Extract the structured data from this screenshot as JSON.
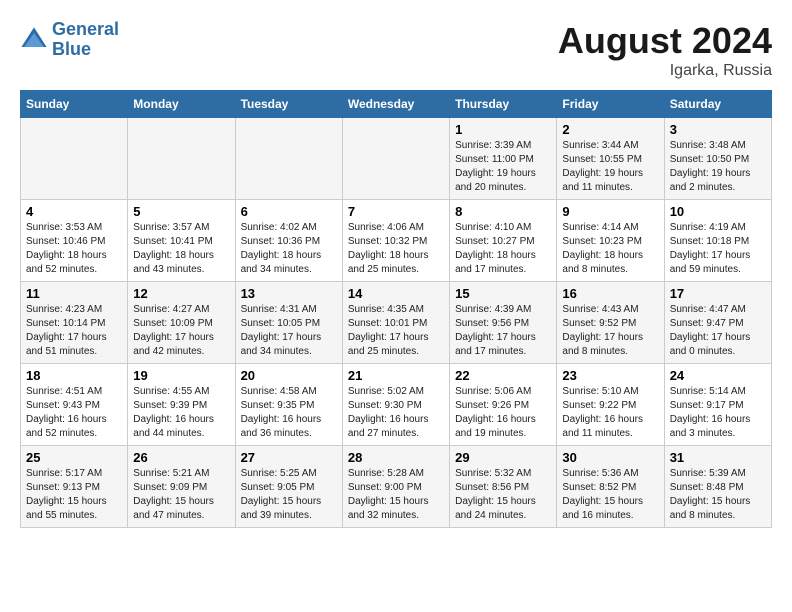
{
  "header": {
    "logo_line1": "General",
    "logo_line2": "Blue",
    "month_year": "August 2024",
    "location": "Igarka, Russia"
  },
  "weekdays": [
    "Sunday",
    "Monday",
    "Tuesday",
    "Wednesday",
    "Thursday",
    "Friday",
    "Saturday"
  ],
  "weeks": [
    [
      {
        "day": "",
        "info": ""
      },
      {
        "day": "",
        "info": ""
      },
      {
        "day": "",
        "info": ""
      },
      {
        "day": "",
        "info": ""
      },
      {
        "day": "1",
        "info": "Sunrise: 3:39 AM\nSunset: 11:00 PM\nDaylight: 19 hours\nand 20 minutes."
      },
      {
        "day": "2",
        "info": "Sunrise: 3:44 AM\nSunset: 10:55 PM\nDaylight: 19 hours\nand 11 minutes."
      },
      {
        "day": "3",
        "info": "Sunrise: 3:48 AM\nSunset: 10:50 PM\nDaylight: 19 hours\nand 2 minutes."
      }
    ],
    [
      {
        "day": "4",
        "info": "Sunrise: 3:53 AM\nSunset: 10:46 PM\nDaylight: 18 hours\nand 52 minutes."
      },
      {
        "day": "5",
        "info": "Sunrise: 3:57 AM\nSunset: 10:41 PM\nDaylight: 18 hours\nand 43 minutes."
      },
      {
        "day": "6",
        "info": "Sunrise: 4:02 AM\nSunset: 10:36 PM\nDaylight: 18 hours\nand 34 minutes."
      },
      {
        "day": "7",
        "info": "Sunrise: 4:06 AM\nSunset: 10:32 PM\nDaylight: 18 hours\nand 25 minutes."
      },
      {
        "day": "8",
        "info": "Sunrise: 4:10 AM\nSunset: 10:27 PM\nDaylight: 18 hours\nand 17 minutes."
      },
      {
        "day": "9",
        "info": "Sunrise: 4:14 AM\nSunset: 10:23 PM\nDaylight: 18 hours\nand 8 minutes."
      },
      {
        "day": "10",
        "info": "Sunrise: 4:19 AM\nSunset: 10:18 PM\nDaylight: 17 hours\nand 59 minutes."
      }
    ],
    [
      {
        "day": "11",
        "info": "Sunrise: 4:23 AM\nSunset: 10:14 PM\nDaylight: 17 hours\nand 51 minutes."
      },
      {
        "day": "12",
        "info": "Sunrise: 4:27 AM\nSunset: 10:09 PM\nDaylight: 17 hours\nand 42 minutes."
      },
      {
        "day": "13",
        "info": "Sunrise: 4:31 AM\nSunset: 10:05 PM\nDaylight: 17 hours\nand 34 minutes."
      },
      {
        "day": "14",
        "info": "Sunrise: 4:35 AM\nSunset: 10:01 PM\nDaylight: 17 hours\nand 25 minutes."
      },
      {
        "day": "15",
        "info": "Sunrise: 4:39 AM\nSunset: 9:56 PM\nDaylight: 17 hours\nand 17 minutes."
      },
      {
        "day": "16",
        "info": "Sunrise: 4:43 AM\nSunset: 9:52 PM\nDaylight: 17 hours\nand 8 minutes."
      },
      {
        "day": "17",
        "info": "Sunrise: 4:47 AM\nSunset: 9:47 PM\nDaylight: 17 hours\nand 0 minutes."
      }
    ],
    [
      {
        "day": "18",
        "info": "Sunrise: 4:51 AM\nSunset: 9:43 PM\nDaylight: 16 hours\nand 52 minutes."
      },
      {
        "day": "19",
        "info": "Sunrise: 4:55 AM\nSunset: 9:39 PM\nDaylight: 16 hours\nand 44 minutes."
      },
      {
        "day": "20",
        "info": "Sunrise: 4:58 AM\nSunset: 9:35 PM\nDaylight: 16 hours\nand 36 minutes."
      },
      {
        "day": "21",
        "info": "Sunrise: 5:02 AM\nSunset: 9:30 PM\nDaylight: 16 hours\nand 27 minutes."
      },
      {
        "day": "22",
        "info": "Sunrise: 5:06 AM\nSunset: 9:26 PM\nDaylight: 16 hours\nand 19 minutes."
      },
      {
        "day": "23",
        "info": "Sunrise: 5:10 AM\nSunset: 9:22 PM\nDaylight: 16 hours\nand 11 minutes."
      },
      {
        "day": "24",
        "info": "Sunrise: 5:14 AM\nSunset: 9:17 PM\nDaylight: 16 hours\nand 3 minutes."
      }
    ],
    [
      {
        "day": "25",
        "info": "Sunrise: 5:17 AM\nSunset: 9:13 PM\nDaylight: 15 hours\nand 55 minutes."
      },
      {
        "day": "26",
        "info": "Sunrise: 5:21 AM\nSunset: 9:09 PM\nDaylight: 15 hours\nand 47 minutes."
      },
      {
        "day": "27",
        "info": "Sunrise: 5:25 AM\nSunset: 9:05 PM\nDaylight: 15 hours\nand 39 minutes."
      },
      {
        "day": "28",
        "info": "Sunrise: 5:28 AM\nSunset: 9:00 PM\nDaylight: 15 hours\nand 32 minutes."
      },
      {
        "day": "29",
        "info": "Sunrise: 5:32 AM\nSunset: 8:56 PM\nDaylight: 15 hours\nand 24 minutes."
      },
      {
        "day": "30",
        "info": "Sunrise: 5:36 AM\nSunset: 8:52 PM\nDaylight: 15 hours\nand 16 minutes."
      },
      {
        "day": "31",
        "info": "Sunrise: 5:39 AM\nSunset: 8:48 PM\nDaylight: 15 hours\nand 8 minutes."
      }
    ]
  ]
}
